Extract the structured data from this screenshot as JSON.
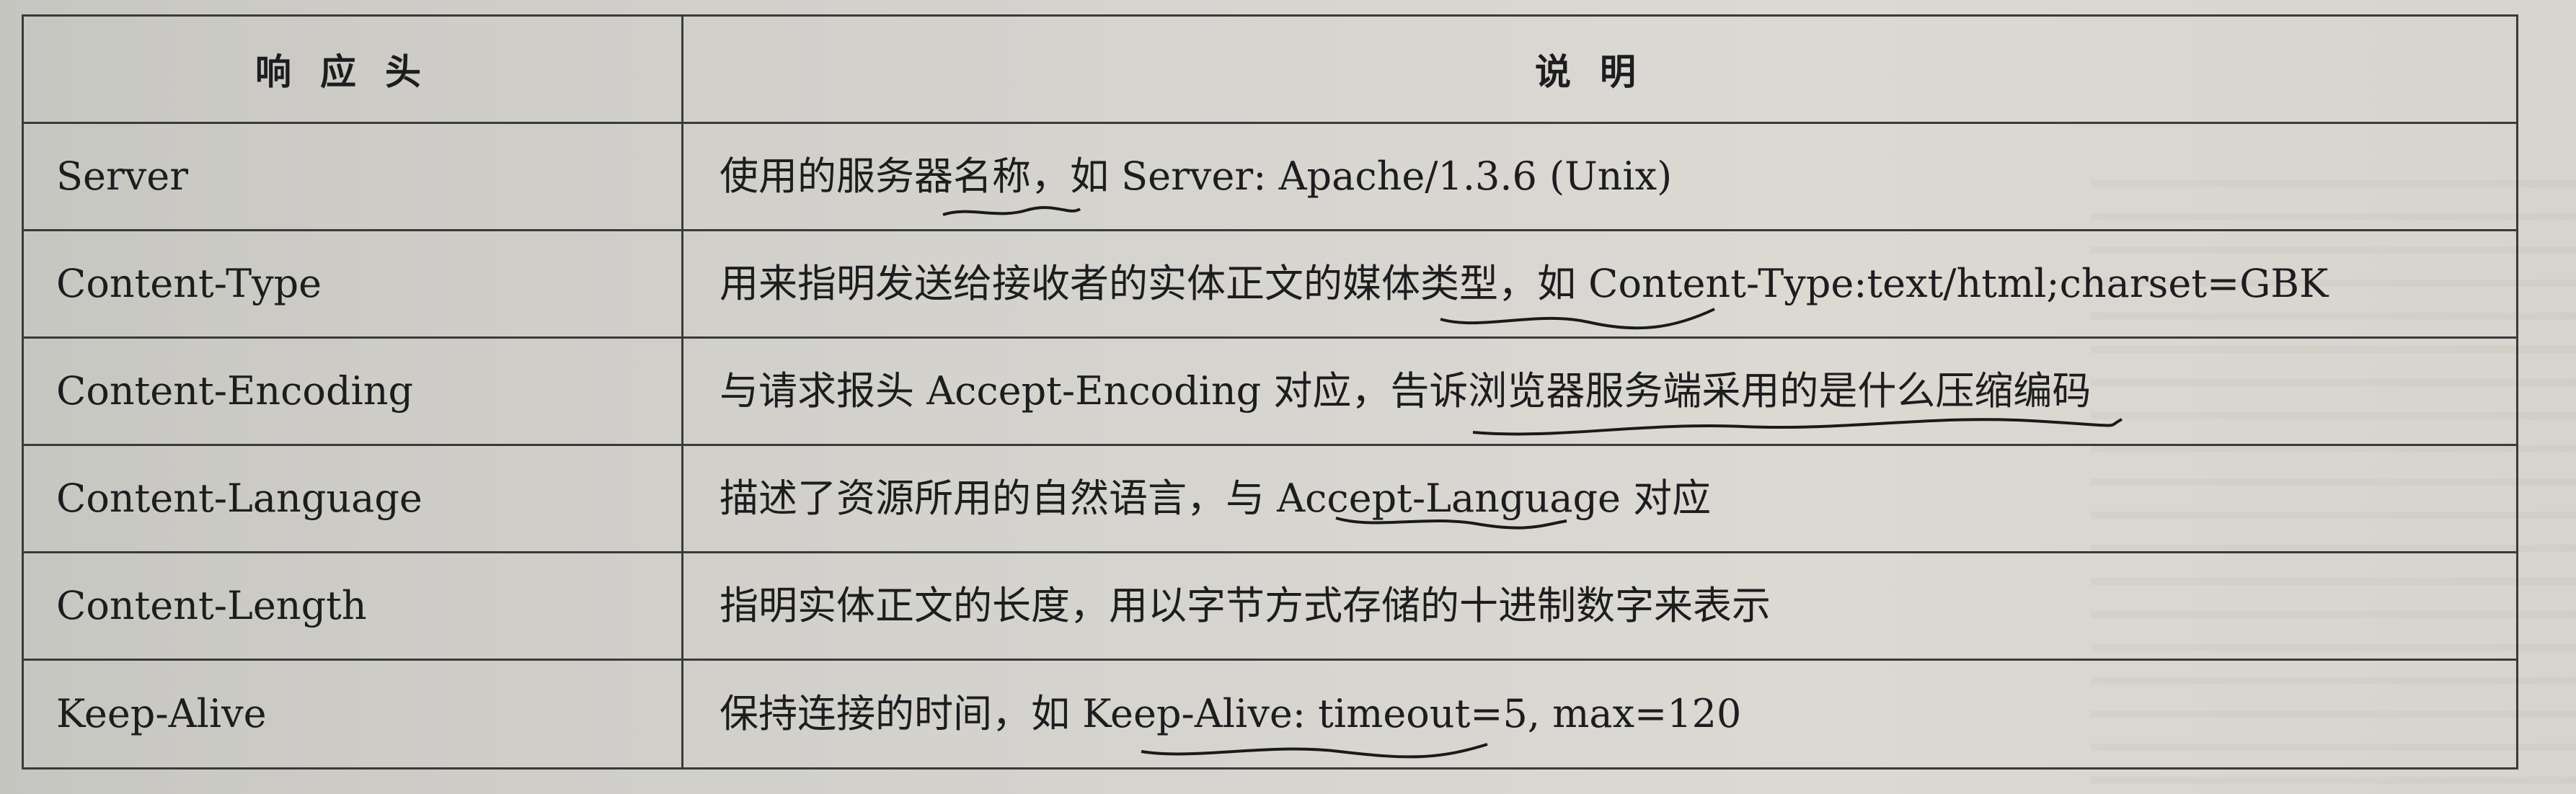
{
  "table": {
    "headers": [
      "响应头",
      "说明"
    ],
    "rows": [
      {
        "name": "Server",
        "desc": "使用的服务器名称，如 Server: Apache/1.3.6 (Unix)"
      },
      {
        "name": "Content-Type",
        "desc": "用来指明发送给接收者的实体正文的媒体类型，如 Content-Type:text/html;charset=GBK"
      },
      {
        "name": "Content-Encoding",
        "desc": "与请求报头 Accept-Encoding 对应，告诉浏览器服务端采用的是什么压缩编码"
      },
      {
        "name": "Content-Language",
        "desc": "描述了资源所用的自然语言，与 Accept-Language 对应"
      },
      {
        "name": "Content-Length",
        "desc": "指明实体正文的长度，用以字节方式存储的十进制数字来表示"
      },
      {
        "name": "Keep-Alive",
        "desc": "保持连接的时间，如 Keep-Alive: timeout=5, max=120"
      }
    ]
  }
}
